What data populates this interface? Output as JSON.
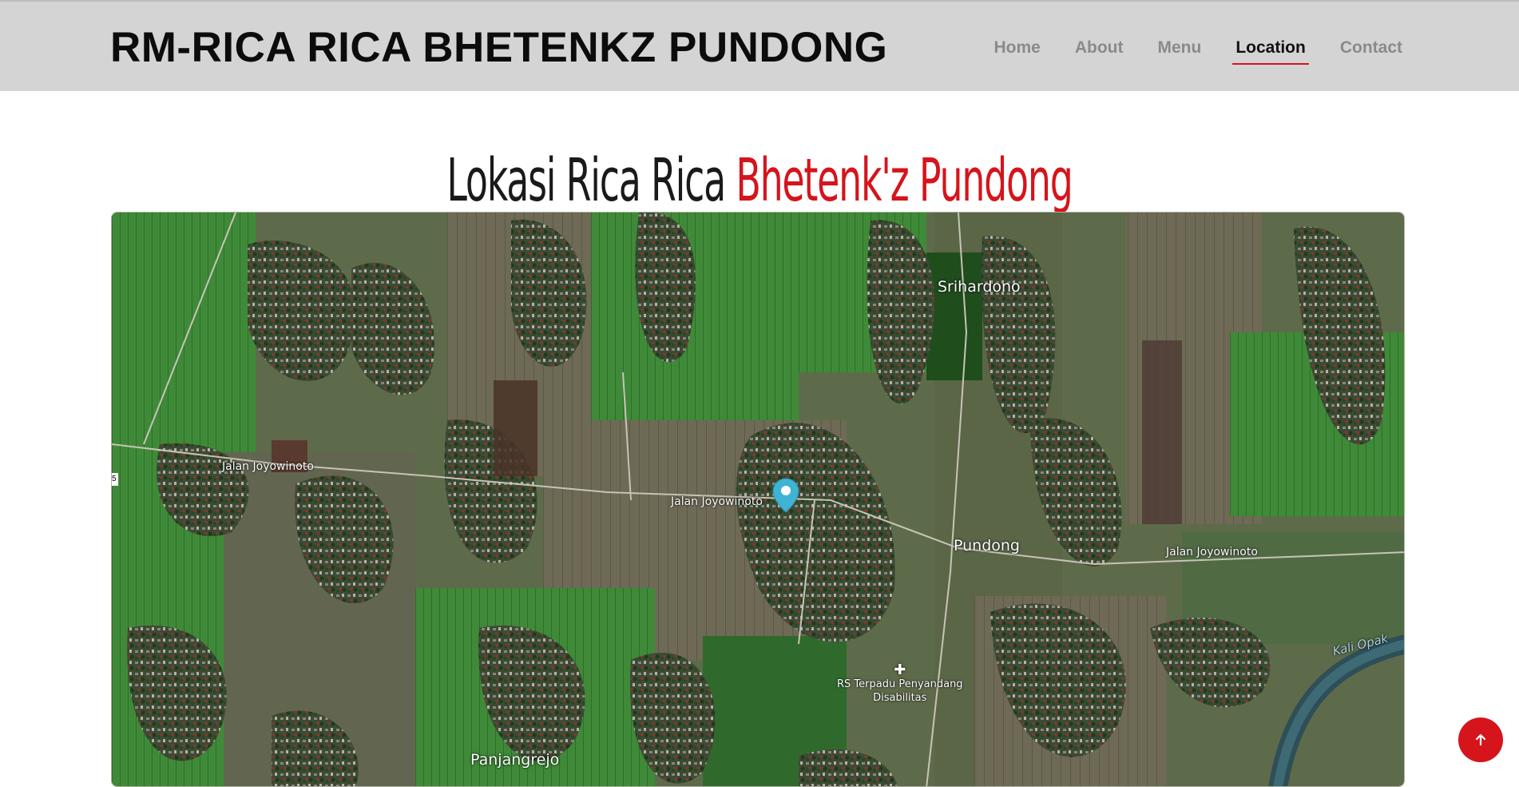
{
  "brand": "RM-RICA RICA BHETENKZ PUNDONG",
  "nav": {
    "items": [
      {
        "label": "Home",
        "active": false
      },
      {
        "label": "About",
        "active": false
      },
      {
        "label": "Menu",
        "active": false
      },
      {
        "label": "Location",
        "active": true
      },
      {
        "label": "Contact",
        "active": false
      }
    ]
  },
  "heading": {
    "prefix": "Lokasi Rica Rica ",
    "accent": "Bhetenk'z Pundong"
  },
  "map": {
    "labels": {
      "srihardono": "Srihardono",
      "pundong": "Pundong",
      "panjangrejo": "Panjangrejo",
      "road_west": "Jalan Joyowinoto",
      "road_center": "Jalan Joyowinoto",
      "road_east": "Jalan Joyowinoto",
      "hospital_line1": "RS Terpadu Penyandang",
      "hospital_line2": "Disabilitas",
      "river": "Kali Opak",
      "edge_tab": "5"
    },
    "marker_icon": "map-pin-icon"
  },
  "scroll_top": {
    "icon": "arrow-up-icon"
  },
  "colors": {
    "accent": "#d5141c",
    "header_bg": "#d4d4d4",
    "nav_text": "#8a8a8e",
    "marker": "#3fb3d3"
  }
}
